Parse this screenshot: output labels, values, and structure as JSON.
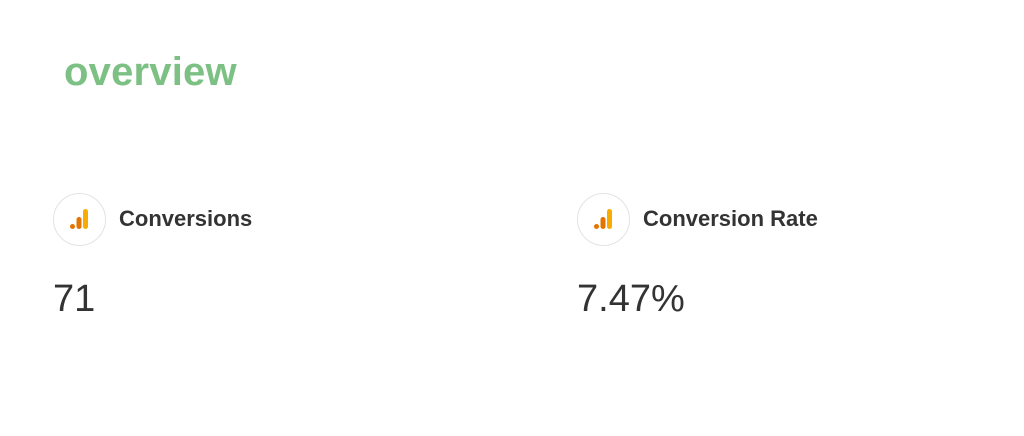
{
  "page": {
    "title": "overview"
  },
  "metrics": [
    {
      "label": "Conversions",
      "value": "71",
      "icon": "analytics-bars-icon"
    },
    {
      "label": "Conversion Rate",
      "value": "7.47%",
      "icon": "analytics-bars-icon"
    }
  ],
  "colors": {
    "title": "#7cc084",
    "icon_dark_orange": "#e37400",
    "icon_light_orange": "#f9ab00",
    "text": "#333333"
  }
}
